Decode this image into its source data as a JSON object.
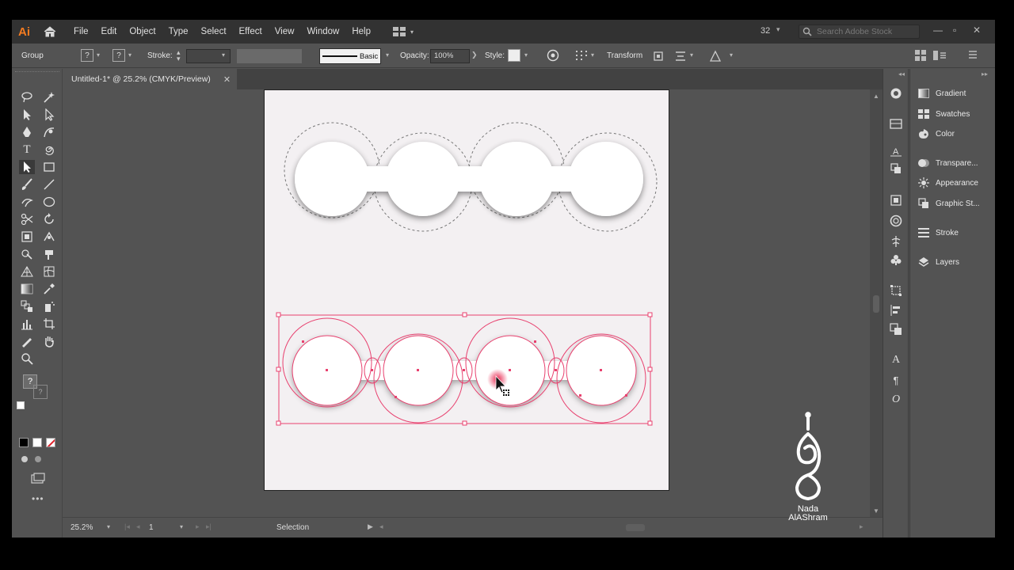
{
  "app": {
    "logo": "Ai",
    "menu": [
      "File",
      "Edit",
      "Object",
      "Type",
      "Select",
      "Effect",
      "View",
      "Window",
      "Help"
    ],
    "zoom_count": "32",
    "search_placeholder": "Search Adobe Stock"
  },
  "control_bar": {
    "selection_type": "Group",
    "stroke_label": "Stroke:",
    "brush_label": "Basic",
    "opacity_label": "Opacity:",
    "opacity_value": "100%",
    "style_label": "Style:",
    "transform_label": "Transform"
  },
  "document": {
    "tab_title": "Untitled-1* @ 25.2% (CMYK/Preview)"
  },
  "status": {
    "zoom": "25.2%",
    "artboard_number": "1",
    "tool_name": "Selection"
  },
  "panels": [
    {
      "label": "Gradient",
      "icon": "gradient-icon"
    },
    {
      "label": "Swatches",
      "icon": "swatches-icon"
    },
    {
      "label": "Color",
      "icon": "color-icon"
    },
    {
      "label": "Transpare...",
      "icon": "transparency-icon"
    },
    {
      "label": "Appearance",
      "icon": "appearance-icon"
    },
    {
      "label": "Graphic St...",
      "icon": "graphic-styles-icon"
    },
    {
      "label": "Stroke",
      "icon": "stroke-icon"
    },
    {
      "label": "Layers",
      "icon": "layers-icon"
    }
  ],
  "watermark": {
    "line1": "Nada",
    "line2": "AlAShram"
  },
  "colors": {
    "selection": "#e8416f",
    "ai_brand": "#f47b20",
    "ui_background": "#535353",
    "menubar": "#323232"
  }
}
